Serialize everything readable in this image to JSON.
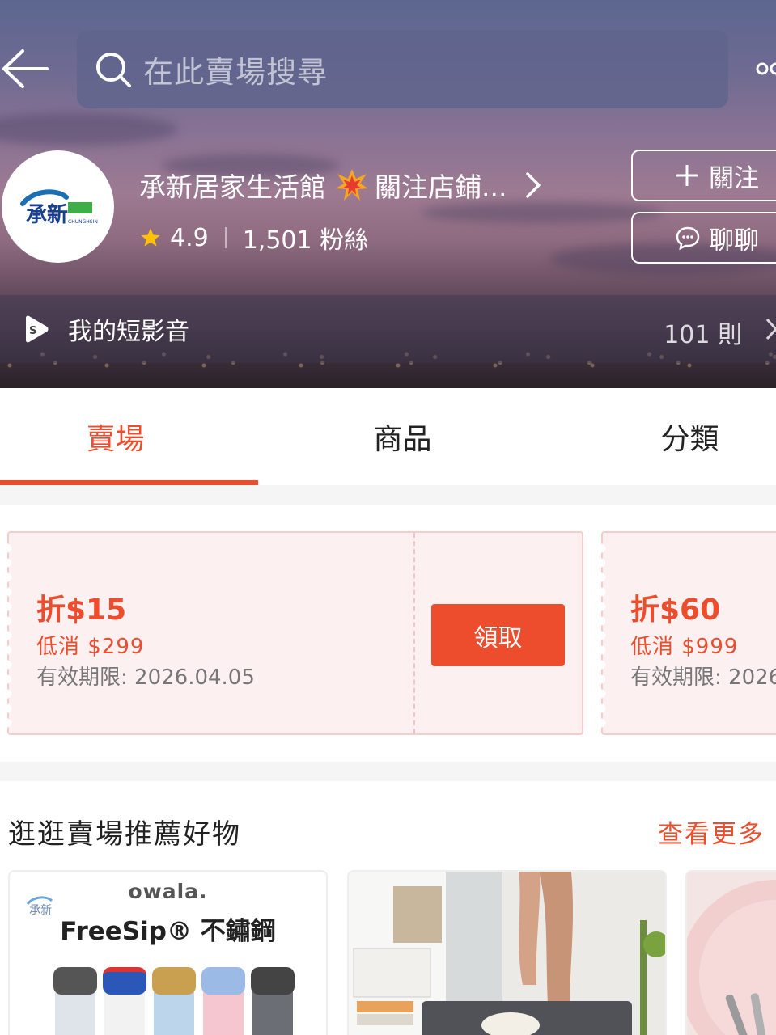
{
  "search": {
    "placeholder": "在此賣場搜尋"
  },
  "shop": {
    "name": "承新居家生活館",
    "name_tail": "關注店鋪...",
    "rating": "4.9",
    "followers": "1,501 粉絲",
    "logo_text": "承新",
    "logo_sub": "CHUNGHSIN"
  },
  "actions": {
    "follow": "關注",
    "chat": "聊聊"
  },
  "video": {
    "label": "我的短影音",
    "count": "101 則"
  },
  "tabs": [
    {
      "label": "賣場",
      "active": true
    },
    {
      "label": "商品",
      "active": false
    },
    {
      "label": "分類",
      "active": false
    }
  ],
  "vouchers": [
    {
      "amount": "折$15",
      "min": "低消 $299",
      "expiry": "有效期限: 2026.04.05",
      "button": "領取"
    },
    {
      "amount": "折$60",
      "min": "低消 $999",
      "expiry": "有效期限: 2026"
    }
  ],
  "recommend": {
    "title": "逛逛賣場推薦好物",
    "more": "查看更多",
    "card1": {
      "brand": "owala.",
      "product": "FreeSip® 不鏽鋼"
    }
  },
  "colors": {
    "accent": "#ee4d2d",
    "voucher_bg": "#fdf0f0"
  }
}
